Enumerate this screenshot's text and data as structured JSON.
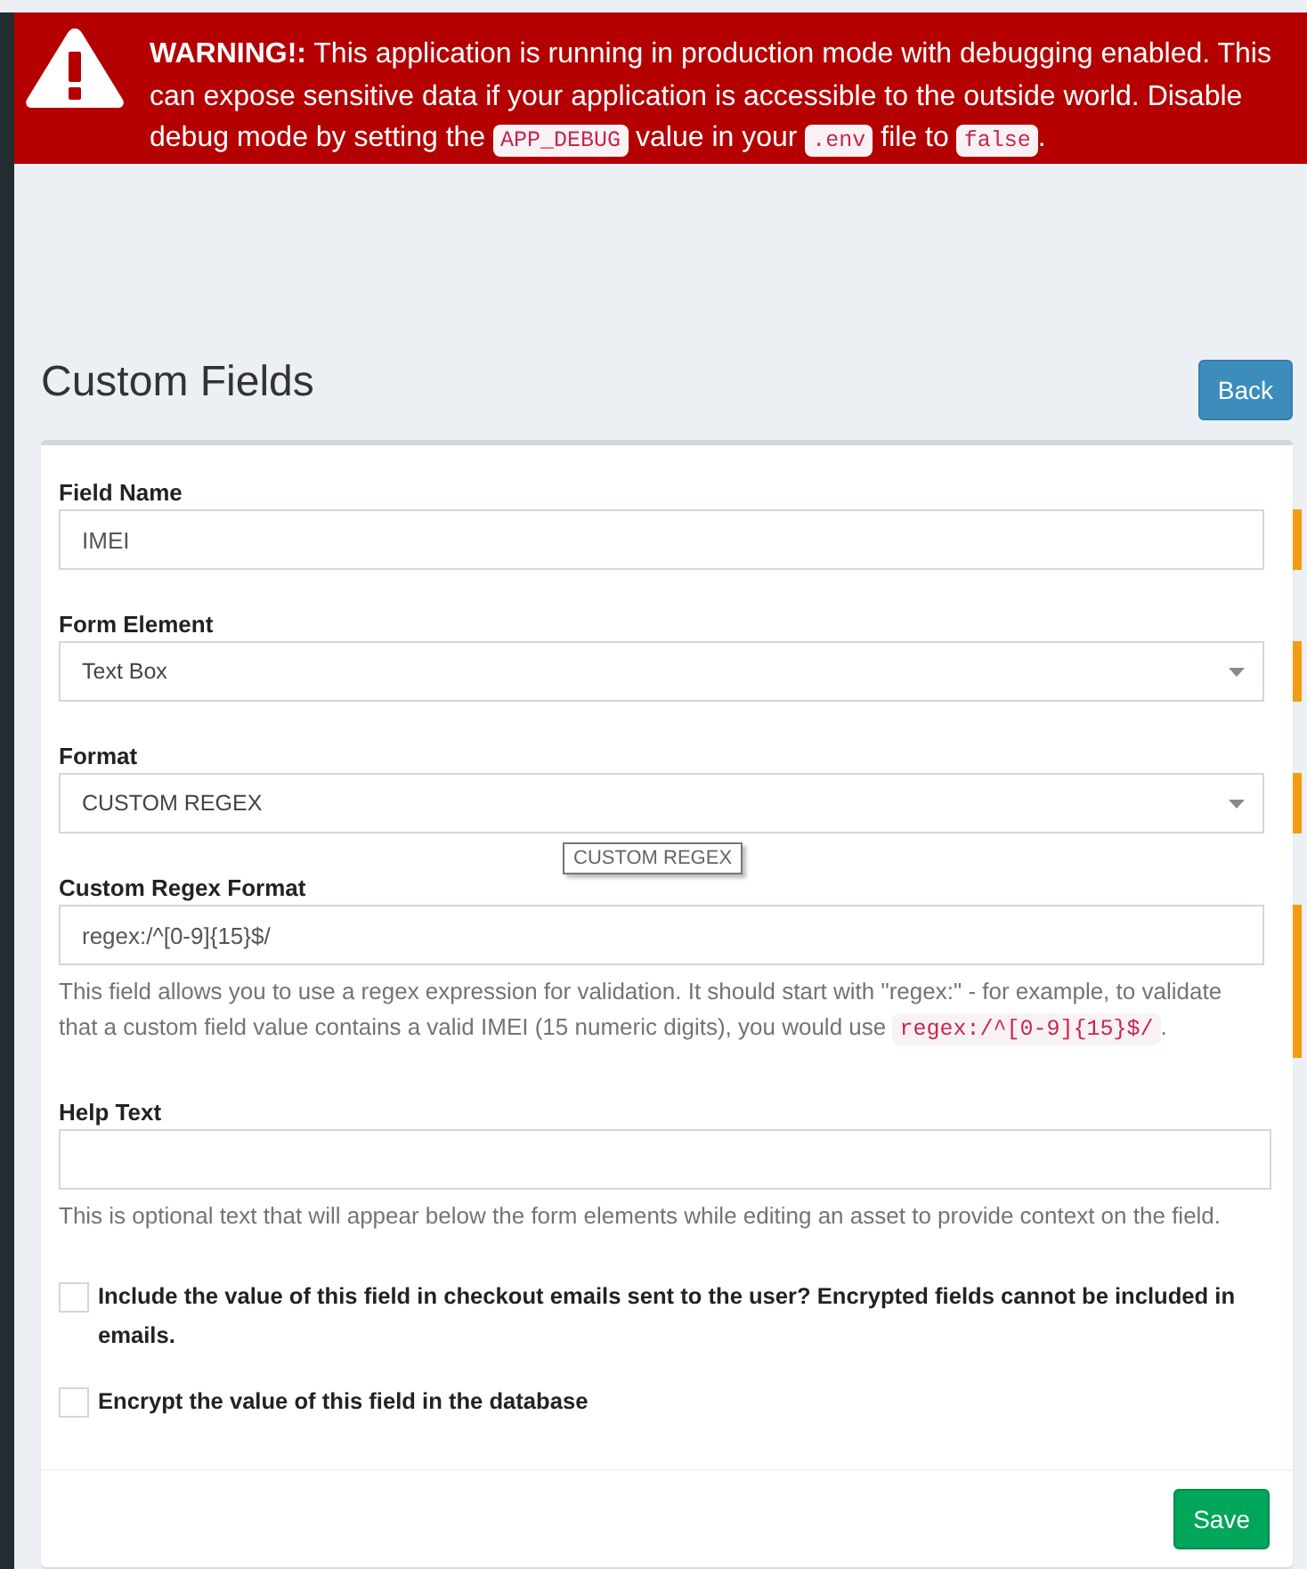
{
  "warning": {
    "parts": [
      {
        "kind": "text",
        "text": "**WARNING!:** This application is running in production mode with debugging enabled. This can expose sensitive data if your application is accessible to the outside world. Disable debug mode by setting the "
      },
      {
        "kind": "code",
        "text": "APP_DEBUG"
      },
      {
        "kind": "text",
        "text": " value in your "
      },
      {
        "kind": "code",
        "text": ".env"
      },
      {
        "kind": "text",
        "text": " file to "
      },
      {
        "kind": "code",
        "text": "false"
      },
      {
        "kind": "text",
        "text": "."
      }
    ]
  },
  "header": {
    "title": "Custom Fields",
    "back_button": "Back"
  },
  "form": {
    "fields": [
      {
        "kind": "text",
        "label": "Field Name",
        "value": "IMEI",
        "required": true
      },
      {
        "kind": "select",
        "label": "Form Element",
        "value": "Text Box",
        "required": true
      },
      {
        "kind": "select",
        "label": "Format",
        "value": "CUSTOM REGEX",
        "required": true,
        "tooltip": "CUSTOM REGEX"
      },
      {
        "kind": "text",
        "label": "Custom Regex Format",
        "value": "regex:/^[0-9]{15}$/",
        "required": true,
        "help": [
          {
            "kind": "text",
            "text": "This field allows you to use a regex expression for validation. It should start with \"regex:\" - for example, to validate that a custom field value contains a valid IMEI (15 numeric digits), you would use "
          },
          {
            "kind": "code",
            "text": "regex:/^[0-9]{15}$/"
          },
          {
            "kind": "text",
            "text": "."
          }
        ]
      },
      {
        "kind": "text",
        "label": "Help Text",
        "required": false,
        "help": [
          {
            "kind": "text",
            "text": "This is optional text that will appear below the form elements while editing an asset to provide context on the field."
          }
        ]
      }
    ],
    "checkboxes": [
      {
        "label": "Include the value of this field in checkout emails sent to the user? Encrypted fields cannot be included in emails.",
        "checked": false
      },
      {
        "label": "Encrypt the value of this field in the database",
        "checked": false
      }
    ],
    "save_button": "Save"
  }
}
